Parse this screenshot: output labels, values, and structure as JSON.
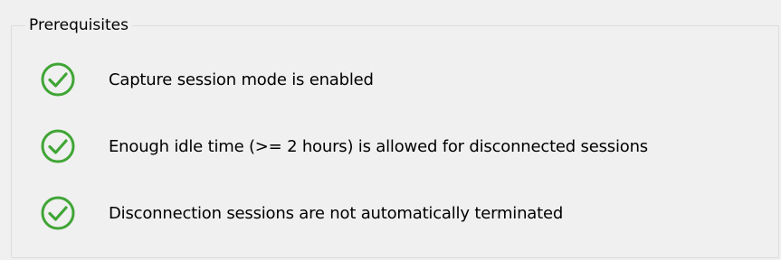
{
  "prerequisites": {
    "title": "Prerequisites",
    "items": [
      {
        "label": "Capture session mode is enabled",
        "icon": "check-circle-icon",
        "status": "passed"
      },
      {
        "label": "Enough idle time (>= 2 hours) is allowed for disconnected sessions",
        "icon": "check-circle-icon",
        "status": "passed"
      },
      {
        "label": "Disconnection sessions are not automatically terminated",
        "icon": "check-circle-icon",
        "status": "passed"
      }
    ]
  },
  "colors": {
    "check_green": "#3fa535",
    "background": "#f0f0f0",
    "border": "#dcdcdc"
  }
}
